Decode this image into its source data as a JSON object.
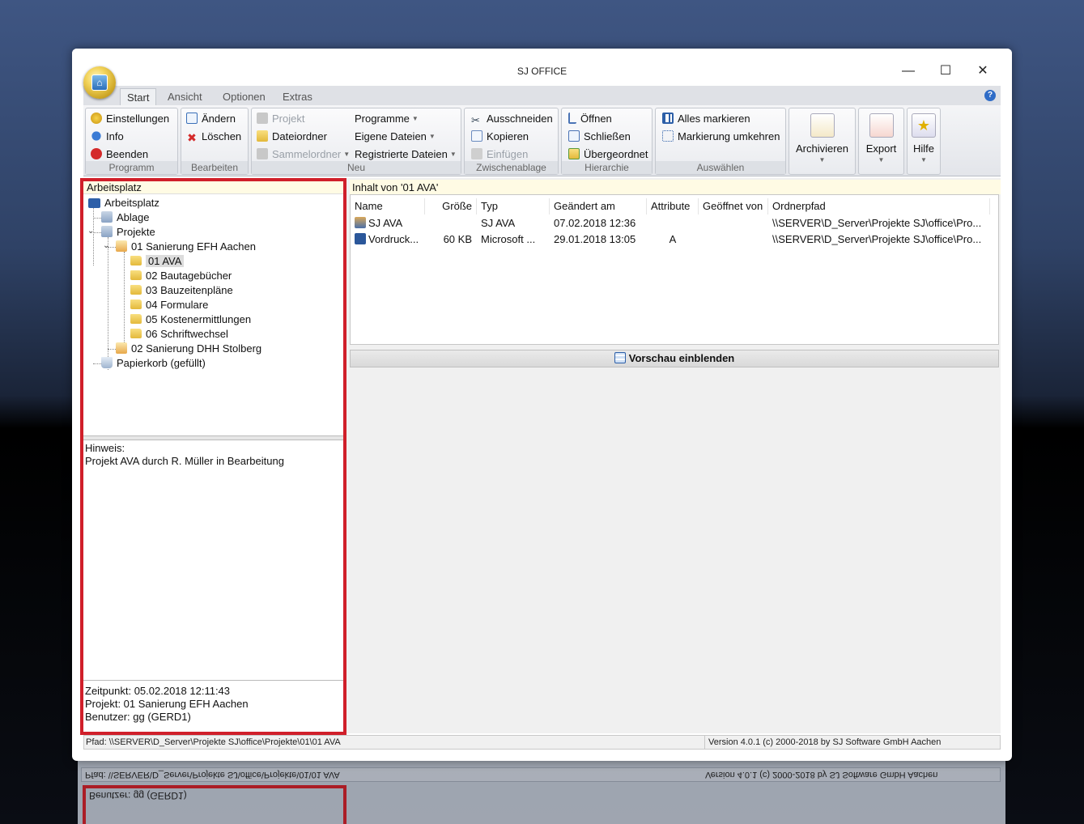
{
  "window": {
    "title": "SJ OFFICE"
  },
  "tabs": [
    "Start",
    "Ansicht",
    "Optionen",
    "Extras"
  ],
  "ribbon": {
    "programm": {
      "label": "Programm",
      "items": [
        "Einstellungen",
        "Info",
        "Beenden"
      ]
    },
    "bearbeiten": {
      "label": "Bearbeiten",
      "items": [
        "Ändern",
        "Löschen"
      ]
    },
    "neu": {
      "label": "Neu",
      "items": [
        "Projekt",
        "Dateiordner",
        "Sammelordner",
        "Programme",
        "Eigene Dateien",
        "Registrierte Dateien"
      ]
    },
    "zwischenablage": {
      "label": "Zwischenablage",
      "items": [
        "Ausschneiden",
        "Kopieren",
        "Einfügen"
      ]
    },
    "hierarchie": {
      "label": "Hierarchie",
      "items": [
        "Öffnen",
        "Schließen",
        "Übergeordnet"
      ]
    },
    "auswaehlen": {
      "label": "Auswählen",
      "items": [
        "Alles markieren",
        "Markierung umkehren"
      ]
    },
    "archivieren": "Archivieren",
    "export": "Export",
    "hilfe": "Hilfe"
  },
  "left": {
    "header": "Arbeitsplatz",
    "tree": {
      "root": "Arbeitsplatz",
      "ablage": "Ablage",
      "projekte": "Projekte",
      "p1": "01 Sanierung EFH Aachen",
      "sub": [
        "01 AVA",
        "02 Bautagebücher",
        "03 Bauzeitenpläne",
        "04 Formulare",
        "05 Kostenermittlungen",
        "06 Schriftwechsel"
      ],
      "p2": "02 Sanierung DHH Stolberg",
      "papierkorb": "Papierkorb (gefüllt)"
    },
    "hint_title": "Hinweis:",
    "hint_text": "Projekt AVA durch R. Müller in Bearbeitung",
    "info": {
      "zeitpunkt": "Zeitpunkt: 05.02.2018 12:11:43",
      "projekt": "Projekt: 01 Sanierung EFH Aachen",
      "benutzer": "Benutzer: gg (GERD1)"
    }
  },
  "right": {
    "header": "Inhalt von '01 AVA'",
    "columns": [
      "Name",
      "Größe",
      "Typ",
      "Geändert am",
      "Attribute",
      "Geöffnet von",
      "Ordnerpfad"
    ],
    "rows": [
      {
        "name": "SJ AVA",
        "size": "",
        "type": "SJ AVA",
        "changed": "07.02.2018 12:36",
        "attr": "",
        "opened": "",
        "path": "\\\\SERVER\\D_Server\\Projekte SJ\\office\\Pro..."
      },
      {
        "name": "Vordruck...",
        "size": "60 KB",
        "type": "Microsoft ...",
        "changed": "29.01.2018 13:05",
        "attr": "A",
        "opened": "",
        "path": "\\\\SERVER\\D_Server\\Projekte SJ\\office\\Pro..."
      }
    ],
    "preview_toggle": "Vorschau einblenden"
  },
  "status": {
    "path": "Pfad: \\\\SERVER\\D_Server\\Projekte SJ\\office\\Projekte\\01\\01 AVA",
    "version": "Version 4.0.1 (c) 2000-2018 by SJ Software GmbH Aachen"
  },
  "colors": {
    "accent_red": "#d01f2a",
    "panel_header": "#fffbe4"
  }
}
